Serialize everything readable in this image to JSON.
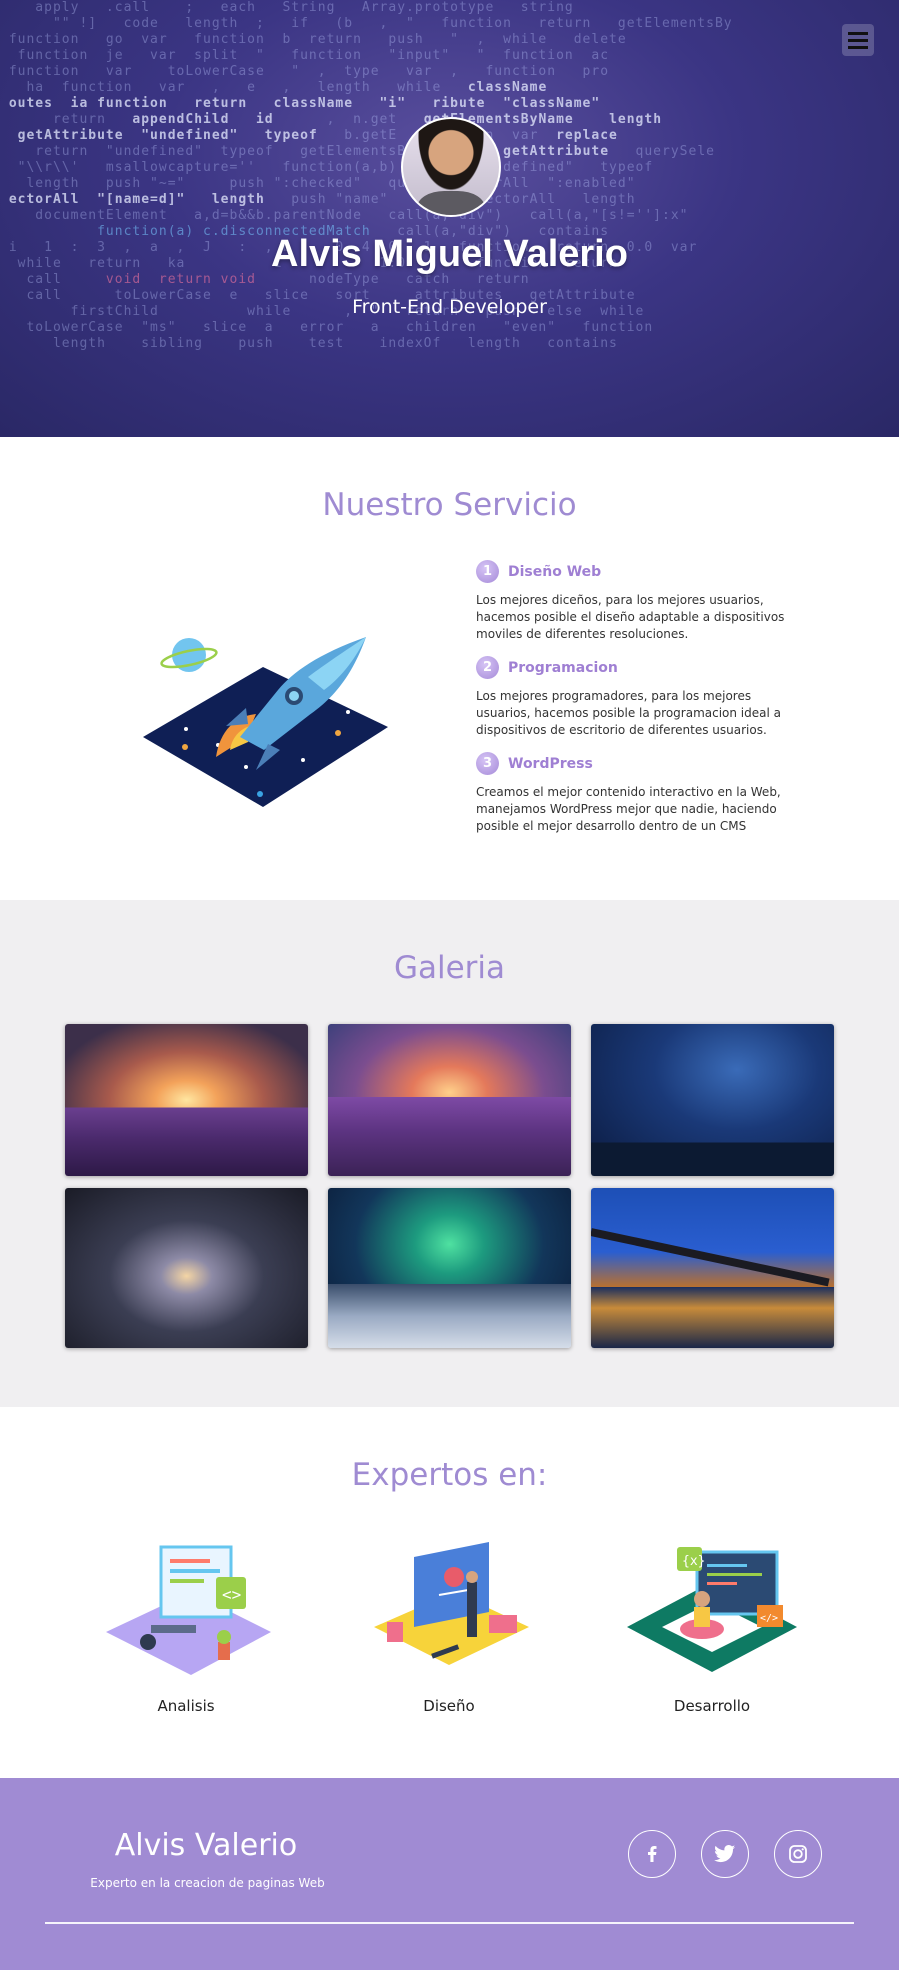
{
  "hero": {
    "name": "Alvis Miguel Valerio",
    "role": "Front-End Developer",
    "menu_icon": "hamburger-icon"
  },
  "services": {
    "title": "Nuestro Servicio",
    "items": [
      {
        "number": "1",
        "title": "Diseño Web",
        "description": "Los mejores diceños, para los mejores usuarios, hacemos posible el diseño adaptable a dispositivos moviles de diferentes resoluciones."
      },
      {
        "number": "2",
        "title": "Programacion",
        "description": "Los mejores programadores, para los mejores usuarios, hacemos posible la programacion ideal a dispositivos de escritorio de diferentes usuarios."
      },
      {
        "number": "3",
        "title": "WordPress",
        "description": "Creamos el mejor contenido interactivo en la Web, manejamos WordPress mejor que nadie, haciendo posible el mejor desarrollo dentro de un CMS"
      }
    ]
  },
  "gallery": {
    "title": "Galeria"
  },
  "experts": {
    "title": "Expertos en:",
    "items": [
      "Analisis",
      "Diseño",
      "Desarrollo"
    ]
  },
  "footer": {
    "name": "Alvis Valerio",
    "tagline": "Experto en la creacion de paginas Web",
    "social_icons": [
      "facebook-icon",
      "twitter-icon",
      "instagram-icon"
    ]
  },
  "colors": {
    "accent": "#9f8bd2",
    "footer_bg": "#a08bd3",
    "hero_bg": "#3b3584"
  }
}
